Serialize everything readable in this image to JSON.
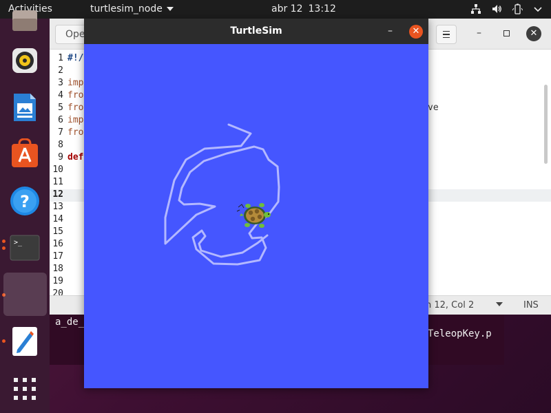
{
  "topbar": {
    "activities": "Activities",
    "app_menu": "turtlesim_node",
    "date": "abr 12",
    "time": "13:12",
    "tray_icons": [
      "network-icon",
      "volume-icon",
      "battery-icon",
      "power-menu-icon"
    ]
  },
  "dock": {
    "items": [
      {
        "name": "files-icon",
        "label": "Files"
      },
      {
        "name": "rhythmbox-icon",
        "label": "Rhythmbox"
      },
      {
        "name": "libreoffice-impress-icon",
        "label": "LibreOffice Impress"
      },
      {
        "name": "ubuntu-software-icon",
        "label": "Ubuntu Software"
      },
      {
        "name": "help-icon",
        "label": "Help"
      },
      {
        "name": "terminal-icon",
        "label": "Terminal"
      },
      {
        "name": "turtlesim-app-icon",
        "label": "turtlesim_node"
      },
      {
        "name": "text-editor-icon",
        "label": "Text Editor"
      },
      {
        "name": "show-applications-icon",
        "label": "Show Applications"
      }
    ],
    "accent": "#e95420"
  },
  "gedit": {
    "open_label": "Ope",
    "lines": [
      {
        "n": "1",
        "code": "#!/"
      },
      {
        "n": "2",
        "code": ""
      },
      {
        "n": "3",
        "code": "imp"
      },
      {
        "n": "4",
        "code": "fro"
      },
      {
        "n": "5",
        "code": "fro"
      },
      {
        "n": "6",
        "code": "imp"
      },
      {
        "n": "7",
        "code": "fro"
      },
      {
        "n": "8",
        "code": ""
      },
      {
        "n": "9",
        "code": "def"
      },
      {
        "n": "10",
        "code": ""
      },
      {
        "n": "11",
        "code": ""
      },
      {
        "n": "12",
        "code": ""
      },
      {
        "n": "13",
        "code": ""
      },
      {
        "n": "14",
        "code": ""
      },
      {
        "n": "15",
        "code": ""
      },
      {
        "n": "16",
        "code": ""
      },
      {
        "n": "17",
        "code": ""
      },
      {
        "n": "18",
        "code": ""
      },
      {
        "n": "19",
        "code": ""
      },
      {
        "n": "20",
        "code": ""
      }
    ],
    "right_fragment": "ve",
    "status_position": "n 12, Col 2",
    "status_mode": "INS"
  },
  "terminal": {
    "left_text": "a_de_D",
    "right_text": "TeleopKey.p"
  },
  "turtlesim": {
    "title": "TurtleSim",
    "minimize": "–",
    "close": "✕",
    "background": "#4556ff",
    "pen_color": "#b3b8ff",
    "turtle_icon": "turtle-icon"
  }
}
